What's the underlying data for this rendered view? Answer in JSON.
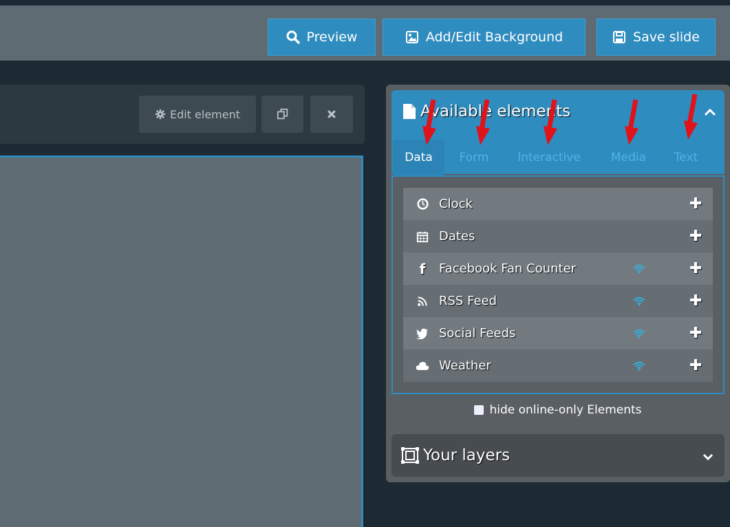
{
  "toolbar": {
    "preview_label": "Preview",
    "background_label": "Add/Edit Background",
    "save_label": "Save slide"
  },
  "editor": {
    "edit_element_label": "Edit element"
  },
  "panel": {
    "title": "Available elements",
    "tabs": [
      {
        "label": "Data",
        "active": true
      },
      {
        "label": "Form",
        "active": false
      },
      {
        "label": "Interactive",
        "active": false
      },
      {
        "label": "Media",
        "active": false
      },
      {
        "label": "Text",
        "active": false
      }
    ],
    "items": [
      {
        "label": "Clock",
        "icon": "clock-icon",
        "online_only": false
      },
      {
        "label": "Dates",
        "icon": "calendar-icon",
        "online_only": false
      },
      {
        "label": "Facebook Fan Counter",
        "icon": "facebook-icon",
        "online_only": true
      },
      {
        "label": "RSS Feed",
        "icon": "rss-icon",
        "online_only": true
      },
      {
        "label": "Social Feeds",
        "icon": "twitter-icon",
        "online_only": true
      },
      {
        "label": "Weather",
        "icon": "cloud-icon",
        "online_only": true
      }
    ],
    "hide_online_label": "hide online-only Elements"
  },
  "layers": {
    "title": "Your layers"
  },
  "colors": {
    "accent": "#2f8cbf",
    "annotation_arrow": "#e0131a"
  }
}
